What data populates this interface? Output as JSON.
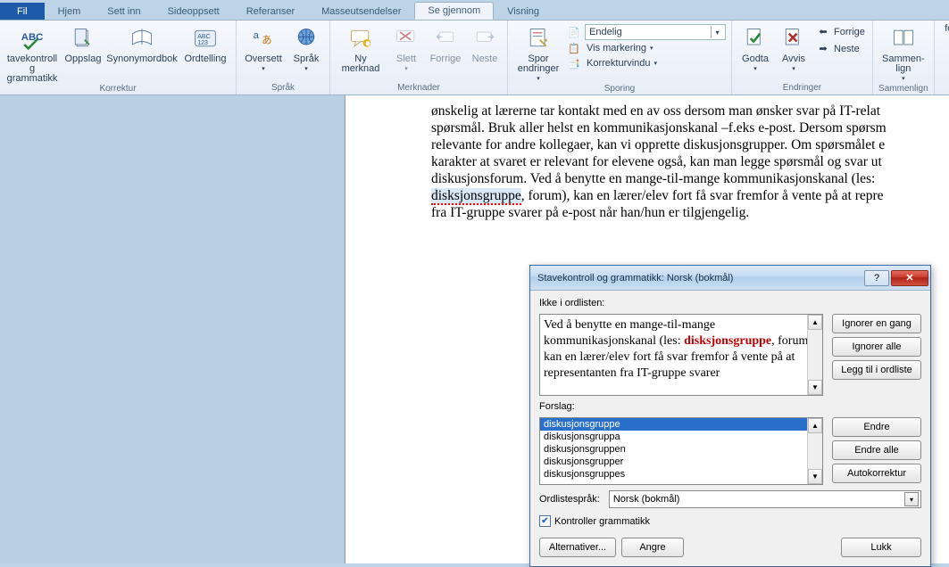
{
  "tabs": {
    "file": "Fil",
    "hjem": "Hjem",
    "settinn": "Sett inn",
    "sideoppsett": "Sideoppsett",
    "referanser": "Referanser",
    "masseutsendelser": "Masseutsendelser",
    "segjennom": "Se gjennom",
    "visning": "Visning"
  },
  "ribbon": {
    "korrektur": {
      "label": "Korrektur",
      "stavekontroll": "tavekontroll\ng grammatikk",
      "oppslag": "Oppslag",
      "synonym": "Synonymordbok",
      "ordtelling": "Ordtelling"
    },
    "sprak": {
      "label": "Språk",
      "oversett": "Oversett",
      "sprak": "Språk"
    },
    "merknader": {
      "label": "Merknader",
      "ny": "Ny\nmerknad",
      "slett": "Slett",
      "forrige": "Forrige",
      "neste": "Neste"
    },
    "sporing": {
      "label": "Sporing",
      "spor": "Spor\nendringer",
      "endelig": "Endelig",
      "vismarkering": "Vis markering",
      "korrekturvindu": "Korrekturvindu"
    },
    "endringer": {
      "label": "Endringer",
      "godta": "Godta",
      "avvis": "Avvis",
      "forrige": "Forrige",
      "neste": "Neste"
    },
    "sammenlign": {
      "label": "Sammenlign",
      "sammenlign": "Sammen-\nlign"
    },
    "fo": "fo"
  },
  "document": {
    "pre": "ønskelig at lærerne tar kontakt med en av oss dersom man ønsker svar på IT-relat\nspørsmål. Bruk aller helst en kommunikasjonskanal –f.eks e-post. Dersom spørsm\nrelevante for andre kollegaer, kan vi opprette diskusjonsgrupper. Om spørsmålet e\nkarakter at svaret er relevant for elevene også, kan man legge spørsmål og svar ut\ndiskusjonsforum. Ved å benytte en mange-til-mange kommunikasjonskanal (les: ",
    "err": "disksjonsgruppe",
    "post": ", forum), kan en lærer/elev fort få svar fremfor å vente på at repre\nfra IT-gruppe svarer på e-post når han/hun er tilgjengelig."
  },
  "dialog": {
    "title": "Stavekontroll og grammatikk: Norsk (bokmål)",
    "notindict": "Ikke i ordlisten:",
    "context_pre": "Ved å benytte en mange-til-mange kommunikasjonskanal (les: ",
    "context_err": "disksjonsgruppe",
    "context_post": ", forum), kan en lærer/elev fort få svar fremfor å vente på at representanten fra IT-gruppe svarer",
    "forslag": "Forslag:",
    "suggestions": [
      "diskusjonsgruppe",
      "diskusjonsgruppa",
      "diskusjonsgruppen",
      "diskusjonsgrupper",
      "diskusjonsgruppes"
    ],
    "ordlistesprak": "Ordlistespråk:",
    "lang": "Norsk (bokmål)",
    "chk": "Kontroller grammatikk",
    "buttons": {
      "ignorer_en": "Ignorer en gang",
      "ignorer_alle": "Ignorer alle",
      "legg_til": "Legg til i ordliste",
      "endre": "Endre",
      "endre_alle": "Endre alle",
      "autokorrektur": "Autokorrektur",
      "alternativer": "Alternativer...",
      "angre": "Angre",
      "lukk": "Lukk"
    }
  }
}
